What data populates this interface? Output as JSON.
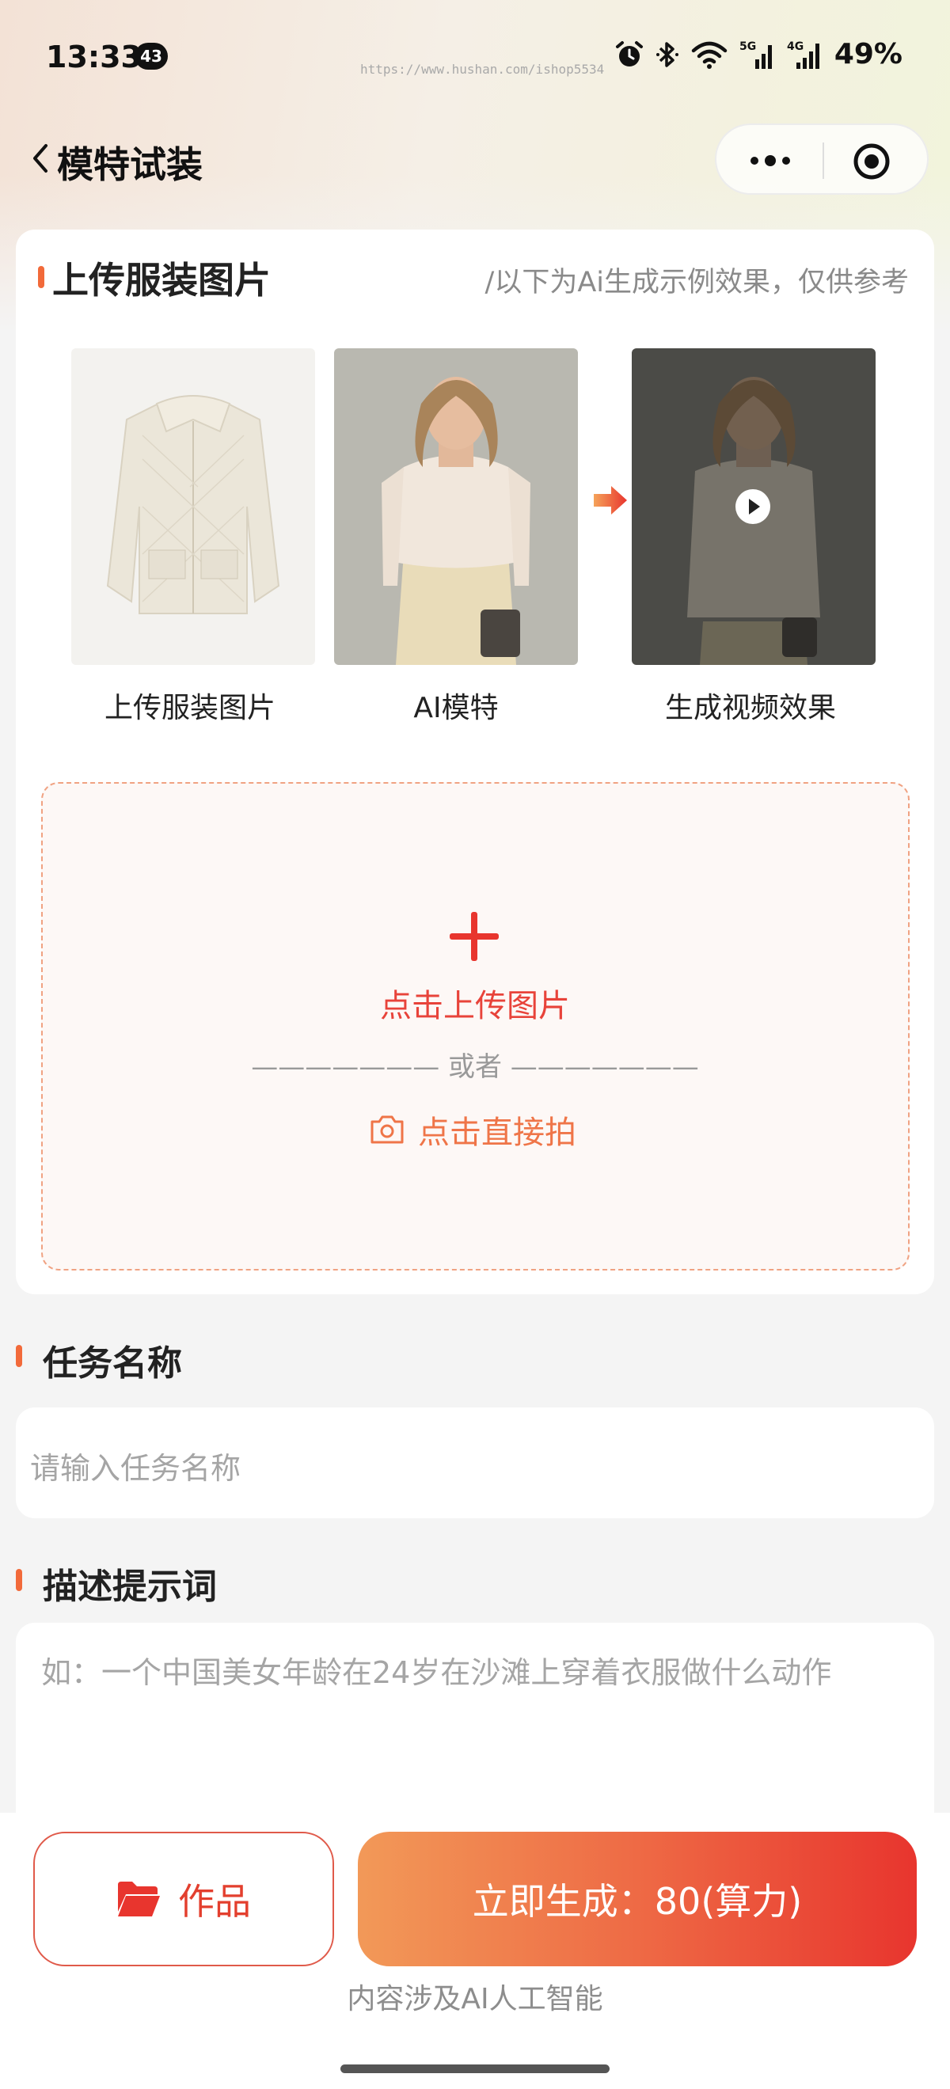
{
  "status_bar": {
    "time": "13:33",
    "notification_count": "43",
    "url_watermark": "https://www.hushan.com/ishop5534",
    "battery": "49%",
    "icons": [
      "alarm-icon",
      "bluetooth-icon",
      "wifi-icon",
      "5g-signal-icon",
      "4g-signal-icon"
    ]
  },
  "nav": {
    "title": "模特试装",
    "back_icon": "chevron-left-icon",
    "capsule_icons": [
      "more-icon",
      "target-icon"
    ]
  },
  "upload_card": {
    "title": "上传服装图片",
    "note": "/以下为Ai生成示例效果，仅供参考",
    "examples": [
      {
        "label": "上传服装图片",
        "image": "cream quilted jacket"
      },
      {
        "label": "AI模特",
        "image": "model in cream blouse"
      },
      {
        "label": "生成视频效果",
        "image": "model wearing jacket video"
      }
    ],
    "upload_label": "点击上传图片",
    "or_text": "——————— 或者 ———————",
    "camera_label": "点击直接拍"
  },
  "task_name": {
    "label": "任务名称",
    "placeholder": "请输入任务名称"
  },
  "prompt": {
    "label": "描述提示词",
    "placeholder": "如：一个中国美女年龄在24岁在沙滩上穿着衣服做什么动作"
  },
  "bottom": {
    "works_label": "作品",
    "generate_label": "立即生成：80(算力)",
    "ai_notice": "内容涉及AI人工智能"
  },
  "colors": {
    "accent": "#f26a3a",
    "primary_red": "#e8433a",
    "gradient_start": "#f29958",
    "gradient_end": "#e8352e"
  }
}
